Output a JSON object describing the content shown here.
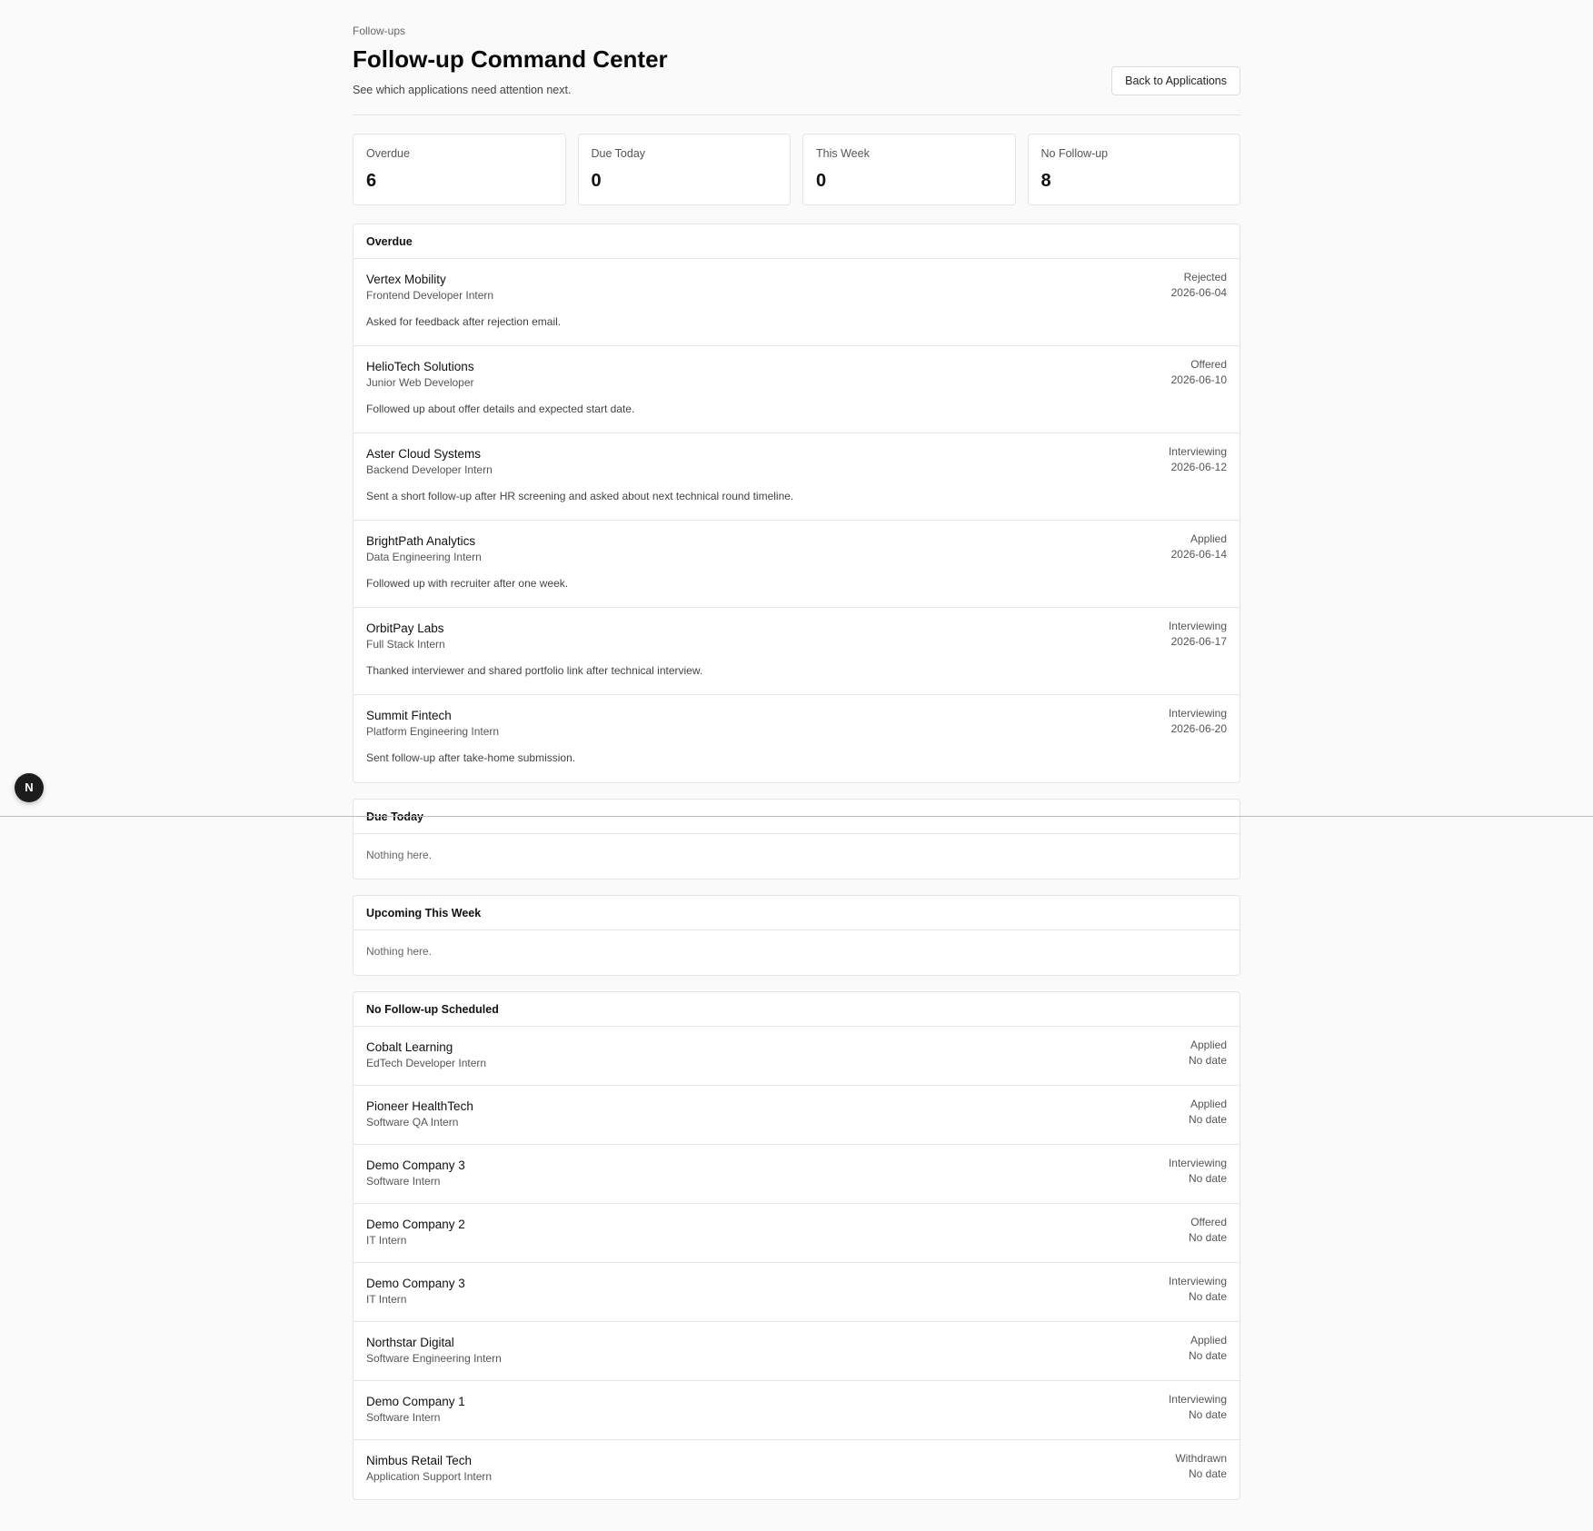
{
  "header": {
    "eyebrow": "Follow-ups",
    "title": "Follow-up Command Center",
    "subtitle": "See which applications need attention next.",
    "back_label": "Back to Applications"
  },
  "stats": [
    {
      "label": "Overdue",
      "value": "6"
    },
    {
      "label": "Due Today",
      "value": "0"
    },
    {
      "label": "This Week",
      "value": "0"
    },
    {
      "label": "No Follow-up",
      "value": "8"
    }
  ],
  "badge": {
    "letter": "N"
  },
  "sections": {
    "overdue": {
      "title": "Overdue",
      "items": [
        {
          "company": "Vertex Mobility",
          "role": "Frontend Developer Intern",
          "note": "Asked for feedback after rejection email.",
          "status": "Rejected",
          "date": "2026-06-04"
        },
        {
          "company": "HelioTech Solutions",
          "role": "Junior Web Developer",
          "note": "Followed up about offer details and expected start date.",
          "status": "Offered",
          "date": "2026-06-10"
        },
        {
          "company": "Aster Cloud Systems",
          "role": "Backend Developer Intern",
          "note": "Sent a short follow-up after HR screening and asked about next technical round timeline.",
          "status": "Interviewing",
          "date": "2026-06-12"
        },
        {
          "company": "BrightPath Analytics",
          "role": "Data Engineering Intern",
          "note": "Followed up with recruiter after one week.",
          "status": "Applied",
          "date": "2026-06-14"
        },
        {
          "company": "OrbitPay Labs",
          "role": "Full Stack Intern",
          "note": "Thanked interviewer and shared portfolio link after technical interview.",
          "status": "Interviewing",
          "date": "2026-06-17"
        },
        {
          "company": "Summit Fintech",
          "role": "Platform Engineering Intern",
          "note": "Sent follow-up after take-home submission.",
          "status": "Interviewing",
          "date": "2026-06-20"
        }
      ]
    },
    "due_today": {
      "title": "Due Today",
      "empty": "Nothing here."
    },
    "this_week": {
      "title": "Upcoming This Week",
      "empty": "Nothing here."
    },
    "no_followup": {
      "title": "No Follow-up Scheduled",
      "items": [
        {
          "company": "Cobalt Learning",
          "role": "EdTech Developer Intern",
          "status": "Applied",
          "date": "No date"
        },
        {
          "company": "Pioneer HealthTech",
          "role": "Software QA Intern",
          "status": "Applied",
          "date": "No date"
        },
        {
          "company": "Demo Company 3",
          "role": "Software Intern",
          "status": "Interviewing",
          "date": "No date"
        },
        {
          "company": "Demo Company 2",
          "role": "IT Intern",
          "status": "Offered",
          "date": "No date"
        },
        {
          "company": "Demo Company 3",
          "role": "IT Intern",
          "status": "Interviewing",
          "date": "No date"
        },
        {
          "company": "Northstar Digital",
          "role": "Software Engineering Intern",
          "status": "Applied",
          "date": "No date"
        },
        {
          "company": "Demo Company 1",
          "role": "Software Intern",
          "status": "Interviewing",
          "date": "No date"
        },
        {
          "company": "Nimbus Retail Tech",
          "role": "Application Support Intern",
          "status": "Withdrawn",
          "date": "No date"
        }
      ]
    }
  }
}
